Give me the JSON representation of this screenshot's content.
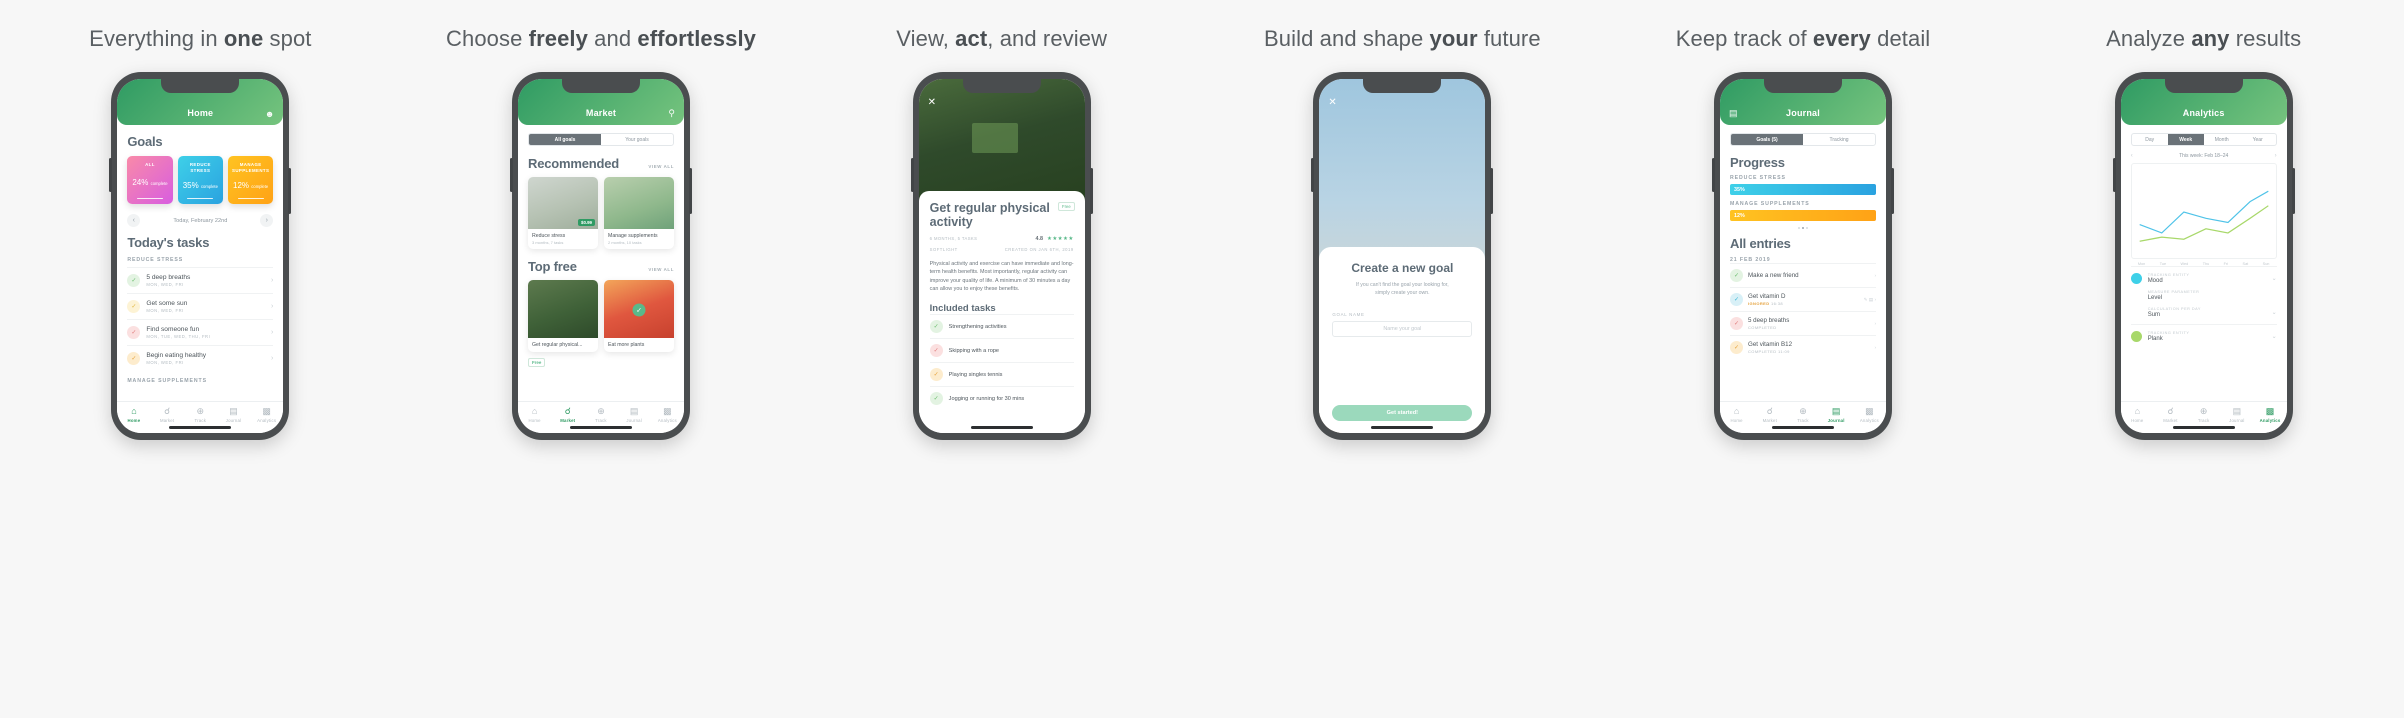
{
  "panels": [
    {
      "caption_pre": "Everything in ",
      "caption_bold": "one",
      "caption_post": " spot",
      "appbar_title": "Home",
      "appbar_icon": "person-icon",
      "section_title": "Goals",
      "goal_cards": [
        {
          "name": "ALL",
          "percent": "24%",
          "suffix": "complete"
        },
        {
          "name": "REDUCE STRESS",
          "percent": "35%",
          "suffix": "complete"
        },
        {
          "name": "MANAGE SUPPLEMENTS",
          "percent": "12%",
          "suffix": "complete"
        }
      ],
      "date_label": "Today, February 22nd",
      "tasks_title": "Today's tasks",
      "group_1": "REDUCE STRESS",
      "group_2": "MANAGE SUPPLEMENTS",
      "tasks": [
        {
          "name": "5 deep breaths",
          "days": "MON, WED, FRI",
          "color": "green"
        },
        {
          "name": "Get some sun",
          "days": "MON, WED, FRI",
          "color": "yellow"
        },
        {
          "name": "Find someone fun",
          "days": "MON, TUE, WED, THU, FRI",
          "color": "red"
        },
        {
          "name": "Begin eating healthy",
          "days": "MON, WED, FRI",
          "color": "orange"
        }
      ],
      "active_tab": "Home"
    },
    {
      "caption_pre": "Choose ",
      "caption_bold": "freely",
      "caption_mid": " and ",
      "caption_bold2": "effortlessly",
      "appbar_title": "Market",
      "appbar_icon": "search-icon",
      "segments": [
        "All goals",
        "Your goals"
      ],
      "segment_active": "All goals",
      "section_1": "Recommended",
      "section_2": "Top free",
      "view_all": "VIEW ALL",
      "cards_1": [
        {
          "name": "Reduce stress",
          "sub": "3 months, 7 tasks",
          "price": "$0.99"
        },
        {
          "name": "Manage supplements",
          "sub": "2 months, 10 tasks",
          "price": ""
        }
      ],
      "cards_2": [
        {
          "name": "Get regular physical...",
          "sub": "",
          "price": "Free"
        },
        {
          "name": "Eat more plants",
          "sub": "",
          "price": ""
        }
      ],
      "active_tab": "Market"
    },
    {
      "caption_pre": "View, ",
      "caption_bold": "act",
      "caption_post": ", and review",
      "close_icon": "close-icon",
      "badge": "Free",
      "title": "Get regular physical activity",
      "duration": "6 MONTHS, 5 TASKS",
      "rating": "4.8",
      "stars": "★★★★★",
      "source_label": "SOFTLIGHT",
      "created": "CREATED ON JAN 6TH, 2019",
      "paragraph": "Physical activity and exercise can have immediate and long-term health benefits. Most importantly, regular activity can improve your quality of life. A minimum of 30 minutes a day can allow you to enjoy these benefits.",
      "included_title": "Included tasks",
      "included": [
        {
          "name": "Strengthening activities",
          "color": "green"
        },
        {
          "name": "Skipping with a rope",
          "color": "red"
        },
        {
          "name": "Playing singles tennis",
          "color": "orange"
        },
        {
          "name": "Jogging or running for 30 mins",
          "color": "green"
        }
      ]
    },
    {
      "caption_pre": "Build and shape ",
      "caption_bold": "your",
      "caption_post": " future",
      "close_icon": "close-icon",
      "title": "Create a new goal",
      "subtitle_1": "If you can't find the goal your looking for,",
      "subtitle_2": "simply create your own.",
      "field_label": "GOAL NAME",
      "field_placeholder": "Name your goal",
      "cta": "Get started!"
    },
    {
      "caption_pre": "Keep track of ",
      "caption_bold": "every",
      "caption_post": " detail",
      "appbar_title": "Journal",
      "appbar_icon": "calendar-icon",
      "segments": [
        "Goals (5)",
        "Tracking"
      ],
      "segment_active": "Goals (5)",
      "progress_title": "Progress",
      "bars": [
        {
          "label": "REDUCE STRESS",
          "value": "35%",
          "color": "cyan"
        },
        {
          "label": "MANAGE SUPPLEMENTS",
          "value": "12%",
          "color": "amber"
        }
      ],
      "entries_title": "All entries",
      "entries_date": "21 FEB 2019",
      "entries": [
        {
          "name": "Make a new friend",
          "status": "",
          "time": "",
          "color": "green"
        },
        {
          "name": "Get vitamin D",
          "status": "IGNORED",
          "time": "16:38",
          "color": "cyan"
        },
        {
          "name": "5 deep breaths",
          "status": "COMPLETED",
          "time": "",
          "color": "red"
        },
        {
          "name": "Get vitamin B12",
          "status": "COMPLETED",
          "time": "11:09",
          "color": "orange"
        }
      ],
      "active_tab": "Journal"
    },
    {
      "caption_pre": "Analyze ",
      "caption_bold": "any",
      "caption_post": " results",
      "appbar_title": "Analytics",
      "ranges": [
        "Day",
        "Week",
        "Month",
        "Year"
      ],
      "range_active": "Week",
      "week_label": "This week: Feb 18–24",
      "x_ticks": [
        "Mon",
        "Tue",
        "Wed",
        "Thu",
        "Fri",
        "Sat",
        "Sun"
      ],
      "metrics": [
        {
          "label": "TRACKING ENTITY",
          "value": "Mood",
          "color": "cyan"
        },
        {
          "label": "MEASURE PARAMETER",
          "value": "Level",
          "color": ""
        },
        {
          "label": "CALCULATION PER DAY",
          "value": "Sum",
          "color": ""
        },
        {
          "label": "TRACKING ENTITY",
          "value": "Plank",
          "color": "lime"
        }
      ],
      "active_tab": "Analytics"
    }
  ],
  "tabbar": [
    {
      "label": "Home",
      "icon": "home-icon",
      "glyph": "⌂"
    },
    {
      "label": "Market",
      "icon": "bag-icon",
      "glyph": "🛍"
    },
    {
      "label": "Track",
      "icon": "plus-circle-icon",
      "glyph": "⊕"
    },
    {
      "label": "Journal",
      "icon": "book-icon",
      "glyph": "▤"
    },
    {
      "label": "Analytics",
      "icon": "chart-icon",
      "glyph": "▥"
    }
  ],
  "colors": {
    "brand_green": "#2f9b63",
    "pink": "#f98aa8",
    "cyan": "#3ed0e8",
    "amber": "#ffc321",
    "text": "#5d6b76"
  },
  "chart_data": {
    "type": "line",
    "title": "",
    "xlabel": "",
    "ylabel": "",
    "x": [
      "Mon",
      "Tue",
      "Wed",
      "Thu",
      "Fri",
      "Sat",
      "Sun"
    ],
    "ylim": [
      0,
      100
    ],
    "grid": false,
    "legend": "none",
    "series": [
      {
        "name": "Mood",
        "color": "#4fc3e8",
        "values": [
          38,
          30,
          52,
          44,
          40,
          62,
          72
        ]
      },
      {
        "name": "Plank",
        "color": "#a8d86a",
        "values": [
          20,
          26,
          22,
          34,
          30,
          46,
          58
        ]
      }
    ]
  }
}
